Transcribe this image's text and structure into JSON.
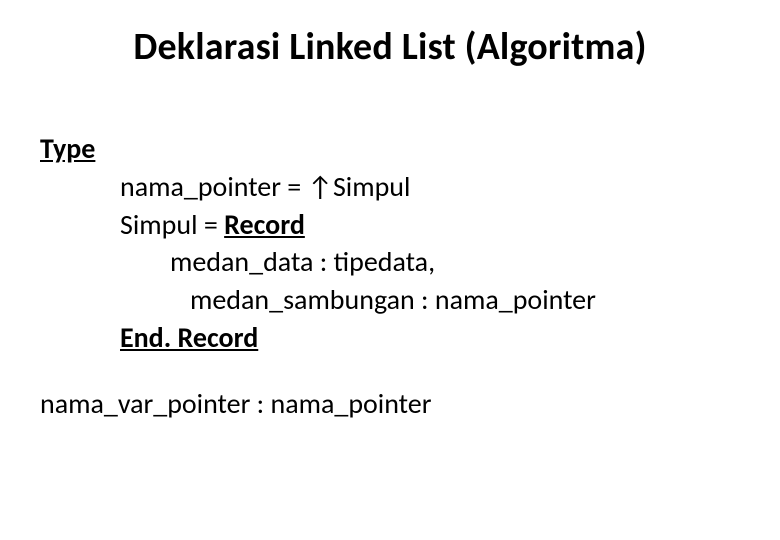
{
  "title": "Deklarasi Linked List (Algoritma)",
  "type_label": "Type",
  "line1_a": "nama_pointer = ",
  "line1_b": "↑",
  "line1_c": "Simpul",
  "line2_a": "Simpul  = ",
  "line2_b": "Record",
  "line3": "medan_data  : tipedata,",
  "line4": "medan_sambungan : nama_pointer",
  "line5": "End. Record",
  "line6": "nama_var_pointer : nama_pointer"
}
